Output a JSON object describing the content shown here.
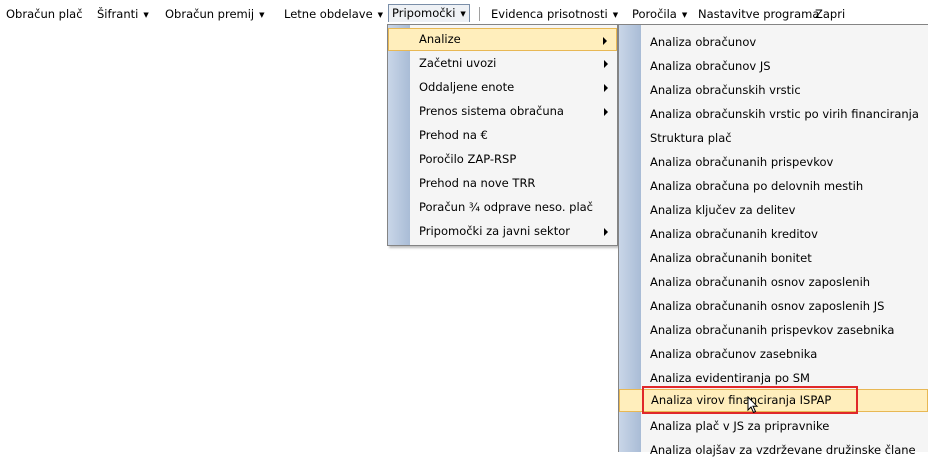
{
  "menubar": {
    "items": [
      {
        "label": "Obračun plač",
        "has_arrow": false
      },
      {
        "label": "Šifranti",
        "has_arrow": true
      },
      {
        "label": "Obračun premij",
        "has_arrow": true
      },
      {
        "label": "Letne obdelave",
        "has_arrow": true
      },
      {
        "label": "Pripomočki",
        "has_arrow": true
      },
      {
        "label": "Evidenca prisotnosti",
        "has_arrow": true
      },
      {
        "label": "Poročila",
        "has_arrow": true
      },
      {
        "label": "Nastavitve programa",
        "has_arrow": false
      },
      {
        "label": "Zapri",
        "has_arrow": false
      }
    ],
    "arrow_glyph": "▼",
    "open_item": "Pripomočki"
  },
  "pripomocki_menu": {
    "items": [
      {
        "label": "Analize",
        "submenu": true,
        "active": true
      },
      {
        "label": "Začetni uvozi",
        "submenu": true
      },
      {
        "label": "Oddaljene enote",
        "submenu": true
      },
      {
        "label": "Prenos sistema obračuna",
        "submenu": true
      },
      {
        "label": "Prehod na €",
        "submenu": false
      },
      {
        "label": "Poročilo ZAP-RSP",
        "submenu": false
      },
      {
        "label": "Prehod na nove TRR",
        "submenu": false
      },
      {
        "label": "Poračun ¾ odprave neso. plač",
        "submenu": false
      },
      {
        "label": "Pripomočki za javni sektor",
        "submenu": true
      }
    ]
  },
  "analize_menu": {
    "items": [
      {
        "label": "Analiza obračunov"
      },
      {
        "label": "Analiza obračunov JS"
      },
      {
        "label": "Analiza obračunskih vrstic"
      },
      {
        "label": "Analiza obračunskih vrstic po virih financiranja"
      },
      {
        "label": "Struktura plač"
      },
      {
        "label": "Analiza obračunanih prispevkov"
      },
      {
        "label": "Analiza obračuna po delovnih mestih"
      },
      {
        "label": "Analiza ključev za delitev"
      },
      {
        "label": "Analiza obračunanih kreditov"
      },
      {
        "label": "Analiza obračunanih bonitet"
      },
      {
        "label": "Analiza obračunanih osnov zaposlenih"
      },
      {
        "label": "Analiza obračunanih osnov zaposlenih JS"
      },
      {
        "label": "Analiza obračunanih prispevkov zasebnika"
      },
      {
        "label": "Analiza obračunov zasebnika"
      },
      {
        "label": "Analiza evidentiranja po SM"
      },
      {
        "label": "Analiza virov financiranja ISPAP",
        "active": true
      },
      {
        "label": "Analiza plač v JS za pripravnike"
      },
      {
        "label": "Analiza olajšav za vzdrževane družinske člane"
      }
    ]
  },
  "colors": {
    "menu_bg": "#f5f5f5",
    "gutter": "#b9cae0",
    "active_bg": "#ffeebc",
    "active_border": "#e8b854",
    "highlight": "#e0282a"
  }
}
